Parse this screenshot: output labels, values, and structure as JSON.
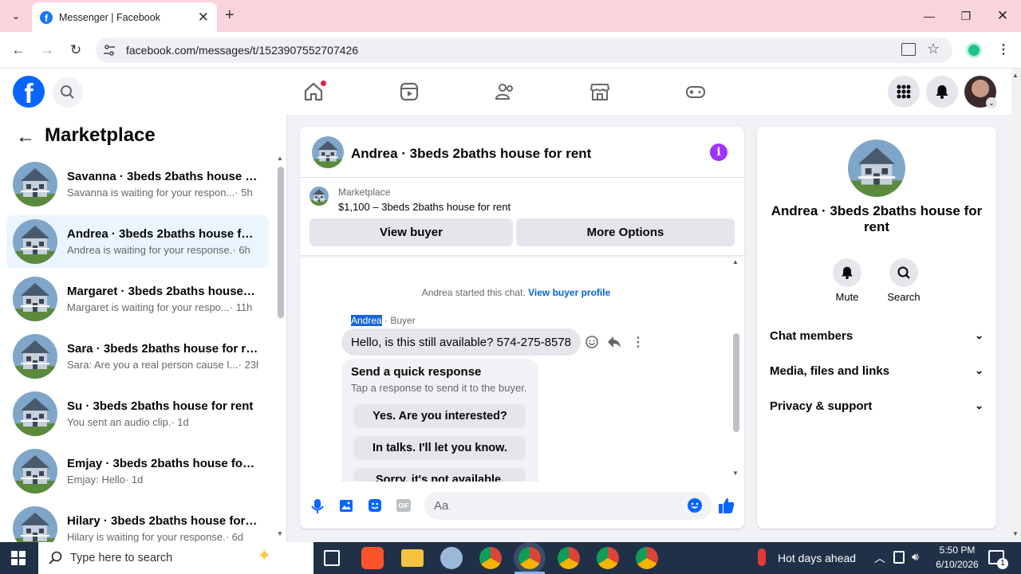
{
  "browser": {
    "tab_title": "Messenger | Facebook",
    "url": "facebook.com/messages/t/1523907552707426"
  },
  "marketplace": {
    "title": "Marketplace",
    "chats": [
      {
        "name": "Savanna · 3beds 2baths house f...",
        "preview": "Savanna is waiting for your respon...",
        "time": "· 5h",
        "active": false
      },
      {
        "name": "Andrea · 3beds 2baths house for...",
        "preview": "Andrea is waiting for your response.",
        "time": "· 6h",
        "active": true
      },
      {
        "name": "Margaret · 3beds 2baths house f...",
        "preview": "Margaret is waiting for your respo...",
        "time": "· 11h",
        "active": false
      },
      {
        "name": "Sara · 3beds 2baths house for rent",
        "preview": "Sara: Are you a real person cause I...",
        "time": "· 23h",
        "active": false
      },
      {
        "name": "Su · 3beds 2baths house for rent",
        "preview": "You sent an audio clip.",
        "time": "· 1d",
        "active": false
      },
      {
        "name": "Emjay · 3beds 2baths house for ...",
        "preview": "Emjay: Hello",
        "time": "· 1d",
        "active": false
      },
      {
        "name": "Hilary · 3beds 2baths house for ...",
        "preview": "Hilary is waiting for your response.",
        "time": "· 6d",
        "active": false
      }
    ]
  },
  "chat": {
    "header_title": "Andrea · 3beds 2baths house for rent",
    "listing_label": "Marketplace",
    "listing_desc": "$1,100 – 3beds 2baths house for rent",
    "view_buyer": "View buyer",
    "more_options": "More Options",
    "started_text": "Andrea started this chat.",
    "view_profile": "View buyer profile",
    "sender": "Andrea",
    "sender_role": "· Buyer",
    "message": "Hello, is this still available? 574-275-8578",
    "quick_title": "Send a quick response",
    "quick_sub": "Tap a response to send it to the buyer.",
    "quick_replies": [
      "Yes. Are you interested?",
      "In talks. I'll let you know.",
      "Sorry, it's not available."
    ],
    "composer_placeholder": "Aa"
  },
  "info": {
    "title": "Andrea · 3beds 2baths house for rent",
    "mute": "Mute",
    "search": "Search",
    "sections": [
      "Chat members",
      "Media, files and links",
      "Privacy & support"
    ]
  },
  "taskbar": {
    "search_placeholder": "Type here to search",
    "weather": "Hot days ahead",
    "time": "5:50 PM",
    "date": "6/10/2026",
    "notif_count": "1"
  },
  "colors": {
    "fb_blue": "#0866ff",
    "messenger_purple": "#a033ff",
    "active_chat_bg": "#ebf5ff",
    "taskbar_bg": "#1f3047",
    "tabstrip_bg": "#f9d4dd"
  }
}
